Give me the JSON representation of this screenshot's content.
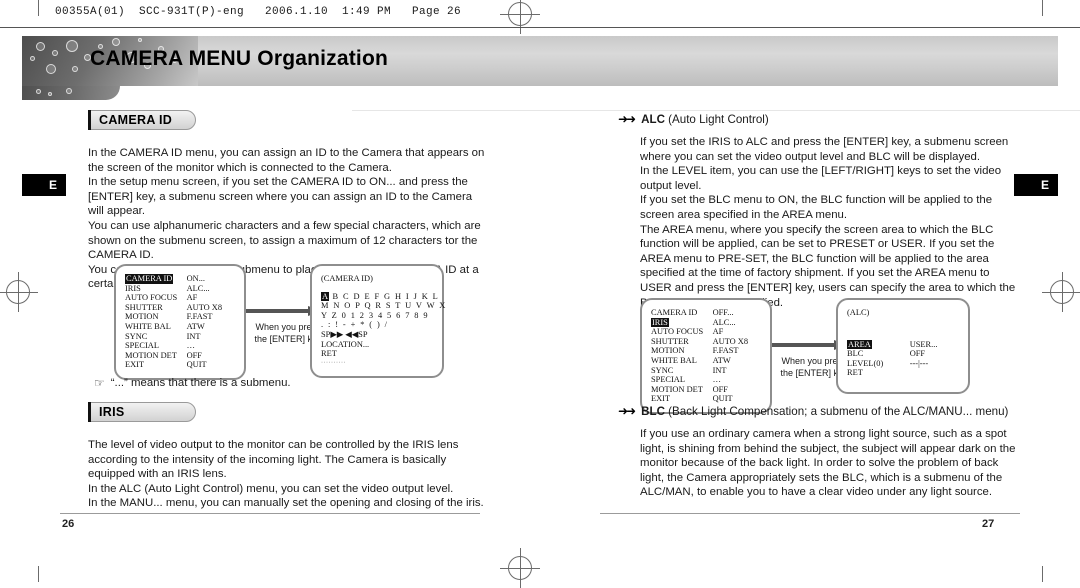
{
  "print_header": "00355A(01)  SCC-931T(P)-eng   2006.1.10  1:49 PM   Page 26",
  "banner": {
    "title": "CAMERA MENU Organization"
  },
  "side_tabs": {
    "left": "E",
    "right": "E"
  },
  "left_page": {
    "section1": {
      "pill": "CAMERA ID",
      "paragraph": "In the CAMERA ID menu, you can assign an ID to the Camera that appears on the screen of the monitor which is connected to the Camera.\nIn the setup menu screen, if you set the CAMERA ID to ON... and press the [ENTER] key, a submenu screen where you can assign an ID to the Camera will appear.\nYou can use alphanumeric characters and a few special characters, which are shown on the submenu screen, to assign a maximum of 12 characters tor the CAMERA ID.\nYou can use the LOCATION submenu to place the assigned CAMERA ID at a certain location on the monitor.",
      "note": "“...” means that there is a submenu.",
      "note_bullet": "hand-pointer-icon"
    },
    "menu_main": {
      "rows": [
        {
          "key": "CAMERA ID",
          "value": "ON...",
          "highlight": "key"
        },
        {
          "key": "IRIS",
          "value": "ALC...",
          "highlight": ""
        },
        {
          "key": "AUTO FOCUS",
          "value": "AF",
          "highlight": ""
        },
        {
          "key": "SHUTTER",
          "value": "AUTO X8",
          "highlight": ""
        },
        {
          "key": "MOTION",
          "value": "F.FAST",
          "highlight": ""
        },
        {
          "key": "WHITE BAL",
          "value": "ATW",
          "highlight": ""
        },
        {
          "key": "SYNC",
          "value": "INT",
          "highlight": ""
        },
        {
          "key": "SPECIAL",
          "value": "…",
          "highlight": ""
        },
        {
          "key": "MOTION DET",
          "value": "OFF",
          "highlight": ""
        },
        {
          "key": "EXIT",
          "value": "QUIT",
          "highlight": ""
        }
      ]
    },
    "arrow_caption": "When you press\nthe [ENTER] key",
    "menu_sub": {
      "title": "(CAMERA ID)",
      "char_rows": [
        "A B C D E F G H I J K L",
        "M N O P Q R S T U V W X",
        "Y Z 0 1 2 3 4 5 6 7 8 9",
        ". : ! - + * ( ) /"
      ],
      "first_char": "A",
      "sp_row": "SP▶▶ ◀◀SP",
      "items": [
        "LOCATION...",
        "RET"
      ],
      "trailing_dots": "··········"
    },
    "section2": {
      "pill": "IRIS",
      "paragraph": "The level of video output to the monitor can be controlled by the IRIS lens according to the intensity of the incoming light. The Camera is basically equipped with an IRIS lens.\nIn the ALC (Auto Light Control) menu, you can set the video output level.\nIn the MANU... menu, you can manually set the opening and closing of the iris."
    },
    "page_number": "26"
  },
  "right_page": {
    "alc": {
      "bullet": "➜➜",
      "title_bold": "ALC",
      "title_rest": "(Auto Light Control)",
      "paragraph": "If you set the IRIS to ALC and press the [ENTER] key, a submenu screen where you can set the video output level and BLC will be displayed.\nIn the LEVEL item, you can use the [LEFT/RIGHT] keys to set the video output level.\nIf you set the BLC menu to ON, the BLC function will be applied to the screen area specified in the AREA menu.\nThe AREA menu, where you specify the screen area to which the BLC function will be applied, can be set to PRESET or USER. If you set the AREA menu to PRE-SET, the BLC function will be applied to the area specified at the time of factory shipment. If you set the AREA menu to USER and press the [ENTER] key, users can specify the area to which the BLC function will be applied."
    },
    "menu_main": {
      "rows": [
        {
          "key": "CAMERA ID",
          "value": "OFF...",
          "highlight": ""
        },
        {
          "key": "IRIS",
          "value": "ALC...",
          "highlight": "key"
        },
        {
          "key": "AUTO FOCUS",
          "value": "AF",
          "highlight": ""
        },
        {
          "key": "SHUTTER",
          "value": "AUTO X8",
          "highlight": ""
        },
        {
          "key": "MOTION",
          "value": "F.FAST",
          "highlight": ""
        },
        {
          "key": "WHITE BAL",
          "value": "ATW",
          "highlight": ""
        },
        {
          "key": "SYNC",
          "value": "INT",
          "highlight": ""
        },
        {
          "key": "SPECIAL",
          "value": "…",
          "highlight": ""
        },
        {
          "key": "MOTION DET",
          "value": "OFF",
          "highlight": ""
        },
        {
          "key": "EXIT",
          "value": "QUIT",
          "highlight": ""
        }
      ]
    },
    "arrow_caption": "When you press\nthe [ENTER] key",
    "menu_sub": {
      "title": "(ALC)",
      "rows": [
        {
          "key": "AREA",
          "value": "USER...",
          "highlight": "key"
        },
        {
          "key": "BLC",
          "value": "OFF",
          "highlight": ""
        },
        {
          "key": "LEVEL(0)",
          "value": "---|---",
          "highlight": ""
        },
        {
          "key": "RET",
          "value": "",
          "highlight": ""
        }
      ]
    },
    "blc": {
      "bullet": "➜➜",
      "title_bold": "BLC",
      "title_rest": "(Back Light Compensation; a submenu of the ALC/MANU... menu)",
      "paragraph": "If you use an ordinary camera when a strong light source, such as a spot light, is shining from behind the subject, the subject will appear dark on the monitor because of the back light. In order to solve the problem of back light, the Camera appropriately sets the BLC, which is a submenu of the ALC/MAN, to enable you to have a clear video under any light source."
    },
    "page_number": "27"
  }
}
